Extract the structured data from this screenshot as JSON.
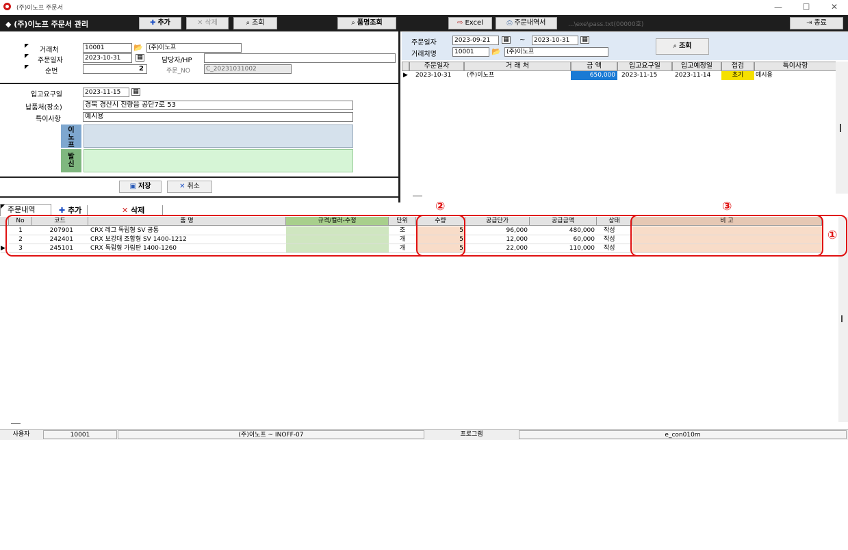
{
  "window": {
    "title": "(주)이노프 주문서",
    "controls": [
      "—",
      "☐",
      "✕"
    ]
  },
  "toolbar": {
    "app_title": "◆ (주)이노프 주문서 관리",
    "add_label": "추가",
    "delete_label": "삭제",
    "search_label": "조회",
    "item_search_label": "품명조회",
    "excel_label": "Excel",
    "order_history_label": "주문내역서",
    "path_text": "...\\exe\\pass.txt(00000호)",
    "exit_label": "종료"
  },
  "form": {
    "client_label": "거래처",
    "client_code": "10001",
    "client_name": "(주)이노프",
    "order_date_label": "주문일자",
    "order_date": "2023-10-31",
    "manager_label": "담당자/HP",
    "manager_value": "",
    "seq_label": "순번",
    "seq_value": "2",
    "order_no_label": "주문_NO",
    "order_no_value": "C_20231031002",
    "request_date_label": "입고요구일",
    "request_date": "2023-11-15",
    "delivery_label": "납품처(장소)",
    "delivery_value": "경북 경산시 진량읍 공단7로 53",
    "note_label": "특이사항",
    "note_value": "예시용",
    "inof_label": "이노프",
    "send_label": "발신",
    "save_label": "저장",
    "cancel_label": "취소"
  },
  "search": {
    "order_date_label": "주문일자",
    "date_from": "2023-09-21",
    "tilde": "~",
    "date_to": "2023-10-31",
    "client_name_label": "거래처명",
    "client_code": "10001",
    "client_name": "(주)이노프",
    "search_button": "조회"
  },
  "order_list": {
    "columns": [
      "주문일자",
      "거 래 처",
      "금 액",
      "입고요구일",
      "입고예정일",
      "접검",
      "특이사항"
    ],
    "rows": [
      {
        "date": "2023-10-31",
        "client": "(주)이노프",
        "amount": "650,000",
        "request": "2023-11-15",
        "expected": "2023-11-14",
        "status": "초기",
        "note": "예시용"
      }
    ]
  },
  "detail_tab": {
    "label": "주문내역",
    "add_label": "추가",
    "delete_label": "삭제"
  },
  "detail_grid": {
    "columns": [
      "No",
      "코드",
      "품 명",
      "규격/컬러-수정",
      "단위",
      "수량",
      "공급단가",
      "공급금액",
      "상태",
      "비 고"
    ],
    "rows": [
      {
        "no": "1",
        "code": "207901",
        "name": "CRX 레그 독립형 SV 공통",
        "spec": "",
        "unit": "조",
        "qty": "5",
        "price": "96,000",
        "amount": "480,000",
        "status": "작성",
        "note": ""
      },
      {
        "no": "2",
        "code": "242401",
        "name": "CRX 보강대 조합형 SV 1400-1212",
        "spec": "",
        "unit": "개",
        "qty": "5",
        "price": "12,000",
        "amount": "60,000",
        "status": "작성",
        "note": ""
      },
      {
        "no": "3",
        "code": "245101",
        "name": "CRX 독립형 가림판 1400-1260",
        "spec": "",
        "unit": "개",
        "qty": "5",
        "price": "22,000",
        "amount": "110,000",
        "status": "작성",
        "note": ""
      }
    ]
  },
  "callouts": [
    "①",
    "②",
    "③"
  ],
  "statusbar": {
    "user_label": "사용자",
    "user_code": "10001",
    "company": "(주)이노프 ~ INOFF-07",
    "program_label": "프로그램",
    "program_id": "e_con010m"
  },
  "colors": {
    "dark_toolbar": "#1e1e1e",
    "search_panel": "#dfe9f5",
    "amount_highlight": "#1a7ad4",
    "status_highlight": "#f5e000",
    "spec_column": "#cfe6c0",
    "qty_column": "#f8dcc8",
    "callout": "#e01010"
  }
}
